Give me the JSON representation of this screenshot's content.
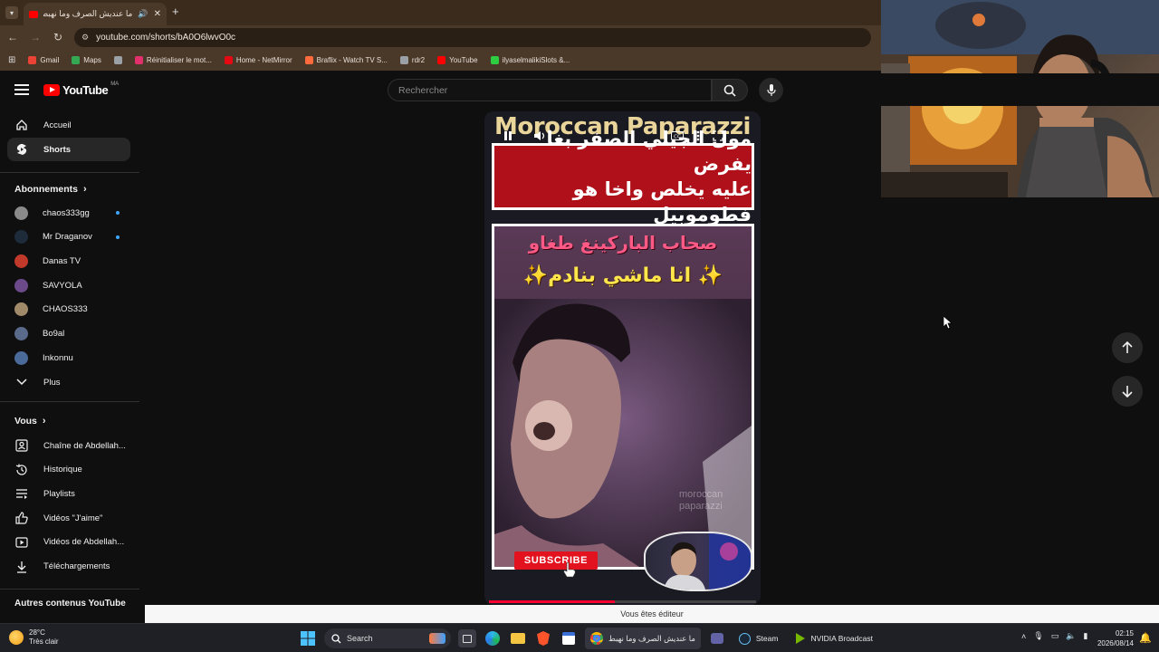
{
  "browser": {
    "tab_title": "ما عنديش الصرف وما نهبط",
    "url": "youtube.com/shorts/bA0O6lwvO0c",
    "bookmarks": [
      {
        "label": "Gmail",
        "color": "#ea4335"
      },
      {
        "label": "Maps",
        "color": "#34a853"
      },
      {
        "label": "",
        "color": "#9aa0a6"
      },
      {
        "label": "Réinitialiser le mot...",
        "color": "#e1306c"
      },
      {
        "label": "Home - NetMirror",
        "color": "#e50914"
      },
      {
        "label": "Braflix - Watch TV S...",
        "color": "#ff6b3d"
      },
      {
        "label": "rdr2",
        "color": "#9aa0a6"
      },
      {
        "label": "YouTube",
        "color": "#ff0000"
      },
      {
        "label": "ilyaselmalikiSlots &...",
        "color": "#2ecc40"
      }
    ]
  },
  "youtube": {
    "logo_text": "YouTube",
    "region": "MA",
    "search_placeholder": "Rechercher"
  },
  "sidebar": {
    "main": [
      {
        "label": "Accueil",
        "icon": "home-icon"
      },
      {
        "label": "Shorts",
        "icon": "shorts-icon",
        "active": true
      }
    ],
    "subscriptions_heading": "Abonnements",
    "subscriptions": [
      {
        "label": "chaos333gg",
        "color": "#8a8a8a",
        "live": true
      },
      {
        "label": "Mr Draganov",
        "color": "#1e2b3a",
        "live": true
      },
      {
        "label": "Danas TV",
        "color": "#c0392b",
        "live": false
      },
      {
        "label": "SAVYOLA",
        "color": "#6c4a8a",
        "live": false
      },
      {
        "label": "CHAOS333",
        "color": "#a08a6a",
        "live": false
      },
      {
        "label": "Bo9al",
        "color": "#5a6a8a",
        "live": false
      },
      {
        "label": "Inkonnu",
        "color": "#4a6a9a",
        "live": false
      }
    ],
    "more_label": "Plus",
    "you_heading": "Vous",
    "you_items": [
      {
        "label": "Chaîne de Abdellah...",
        "icon": "channel-icon"
      },
      {
        "label": "Historique",
        "icon": "history-icon"
      },
      {
        "label": "Playlists",
        "icon": "playlist-icon"
      },
      {
        "label": "Vidéos \"J'aime\"",
        "icon": "like-icon"
      },
      {
        "label": "Vidéos de Abdellah...",
        "icon": "videos-icon"
      },
      {
        "label": "Téléchargements",
        "icon": "download-icon"
      }
    ],
    "other_heading": "Autres contenus YouTube"
  },
  "short": {
    "brand": "Moroccan Paparazzi",
    "banner_line1": "مول الجيلي الصفر بغا يفرض",
    "banner_line2": "عليه يخلص واخا هو فطوموبيل",
    "pink_caption": "صحاب الباركينغ طغاو",
    "yellow_caption": "✨ انا ماشي بنادم✨",
    "watermark_line1": "moroccan",
    "watermark_line2": "paparazzi",
    "subscribe_label": "SUBSCRIBE",
    "progress": 0.47
  },
  "editor_notice": "Vous êtes éditeur",
  "taskbar": {
    "weather_temp": "28°C",
    "weather_desc": "Très clair",
    "search_label": "Search",
    "chrome_window": "ما عنديش الصرف وما نهبط",
    "steam_label": "Steam",
    "nvidia_label": "NVIDIA Broadcast",
    "time": "02:15",
    "date": "2026/08/14"
  },
  "colors": {
    "yt_red": "#ff0000",
    "banner_red": "#b0101a",
    "caption_pink": "#ff5a86",
    "caption_yellow": "#ffe64a",
    "subscribe_red": "#e3121f"
  }
}
